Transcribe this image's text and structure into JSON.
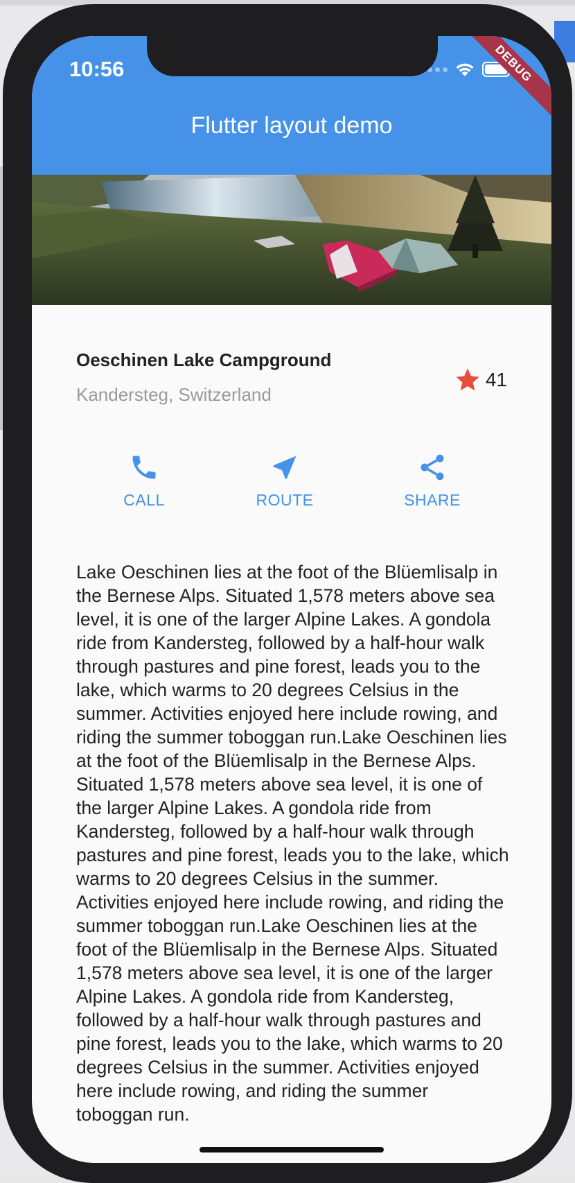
{
  "status_bar": {
    "time": "10:56"
  },
  "debug_banner": "DEBUG",
  "app_bar": {
    "title": "Flutter layout demo",
    "background": "#4592e8"
  },
  "title_section": {
    "name": "Oeschinen Lake Campground",
    "location": "Kandersteg, Switzerland",
    "rating_count": "41",
    "star_color": "#e74c3c"
  },
  "buttons": [
    {
      "label": "CALL",
      "icon": "phone-icon"
    },
    {
      "label": "ROUTE",
      "icon": "navigation-arrow-icon"
    },
    {
      "label": "SHARE",
      "icon": "share-icon"
    }
  ],
  "accent_color": "#4592e8",
  "description": "Lake Oeschinen lies at the foot of the Blüemlisalp in the Bernese Alps. Situated 1,578 meters above sea level, it is one of the larger Alpine Lakes. A gondola ride from Kandersteg, followed by a half-hour walk through pastures and pine forest, leads you to the lake, which warms to 20 degrees Celsius in the summer. Activities enjoyed here include rowing, and riding the summer toboggan run.Lake Oeschinen lies at the foot of the Blüemlisalp in the Bernese Alps. Situated 1,578 meters above sea level, it is one of the larger Alpine Lakes. A gondola ride from Kandersteg, followed by a half-hour walk through pastures and pine forest, leads you to the lake, which warms to 20 degrees Celsius in the summer. Activities enjoyed here include rowing, and riding the summer toboggan run.Lake Oeschinen lies at the foot of the Blüemlisalp in the Bernese Alps. Situated 1,578 meters above sea level, it is one of the larger Alpine Lakes. A gondola ride from Kandersteg, followed by a half-hour walk through pastures and pine forest, leads you to the lake, which warms to 20 degrees Celsius in the summer. Activities enjoyed here include rowing, and riding the summer toboggan run."
}
